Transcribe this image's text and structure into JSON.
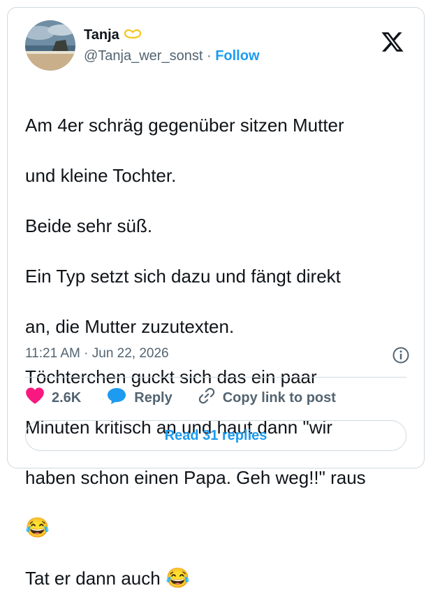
{
  "tweet": {
    "author_name": "Tanja",
    "author_handle": "@Tanja_wer_sonst",
    "separator": "·",
    "follow_label": "Follow",
    "text_lines": [
      "Am 4er schräg gegenüber sitzen Mutter",
      "und kleine Tochter.",
      "Beide sehr süß.",
      "Ein Typ setzt sich dazu und fängt direkt",
      "an, die Mutter zuzutexten.",
      "Töchterchen guckt sich das ein paar",
      "Minuten kritisch an und haut dann \"wir",
      "haben schon einen Papa. Geh weg!!\" raus"
    ],
    "emoji_line_1": "😂",
    "last_line": "Tat er dann auch",
    "emoji_line_2": "😂",
    "timestamp": "11:21 AM · Jun 22, 2026"
  },
  "actions": {
    "likes": "2.6K",
    "reply_label": "Reply",
    "copy_link_label": "Copy link to post"
  },
  "read_replies_label": "Read 31 replies",
  "colors": {
    "like": "#f91880",
    "reply_bubble": "#1d9bf0",
    "accent": "#1d9bf0",
    "border": "#cfd9de"
  },
  "icons": [
    "avatar-image",
    "heart-emoji-icon",
    "x-logo-icon",
    "info-icon",
    "heart-icon",
    "reply-bubble-icon",
    "link-icon"
  ]
}
